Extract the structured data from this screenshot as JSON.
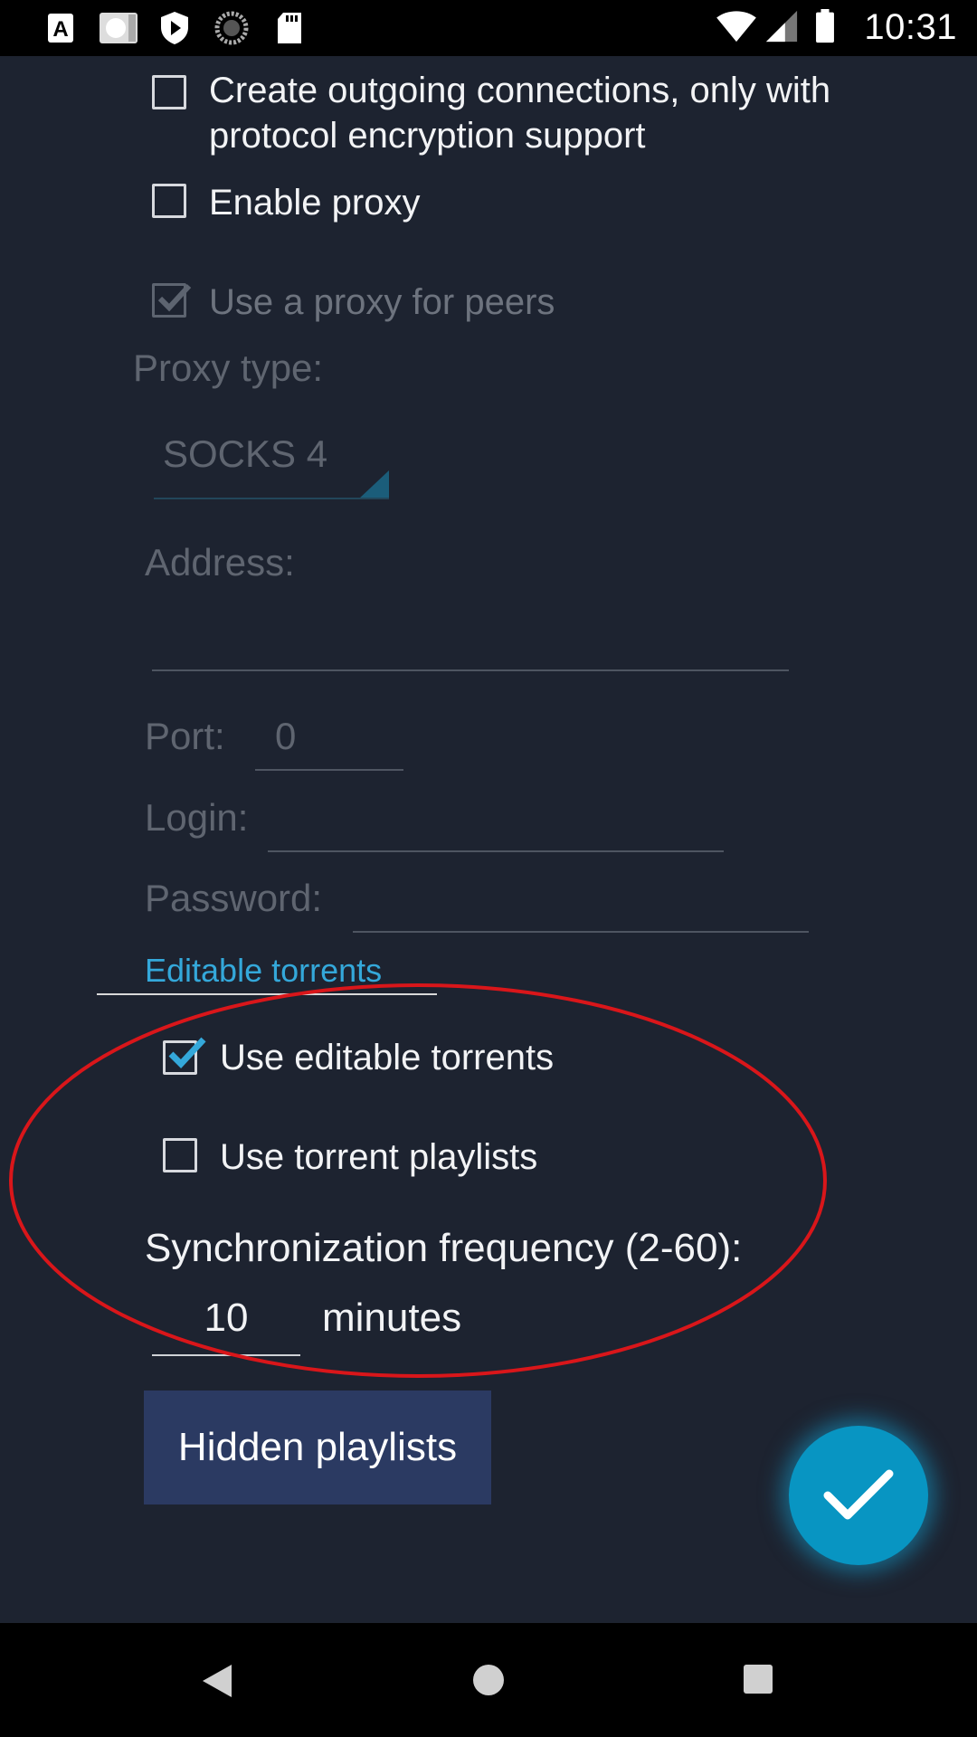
{
  "status_bar": {
    "time": "10:31",
    "left_icons": [
      "accessibility-a-icon",
      "screenshot-icon",
      "play-protect-icon",
      "sync-loading-icon",
      "sd-card-icon"
    ],
    "right_icons": [
      "wifi-icon",
      "signal-icon",
      "battery-icon"
    ]
  },
  "settings": {
    "encryption_only": {
      "label": "Create outgoing connections, only with protocol encryption support",
      "checked": false
    },
    "enable_proxy": {
      "label": "Enable proxy",
      "checked": false
    },
    "proxy_for_peers": {
      "label": "Use a proxy for peers",
      "checked": true,
      "disabled": true
    },
    "proxy_type": {
      "label": "Proxy type:",
      "value": "SOCKS 4"
    },
    "address": {
      "label": "Address:",
      "value": ""
    },
    "port": {
      "label": "Port:",
      "value": "0"
    },
    "login": {
      "label": "Login:",
      "value": ""
    },
    "password": {
      "label": "Password:",
      "value": ""
    }
  },
  "editable_torrents": {
    "section_title": "Editable torrents",
    "use_editable": {
      "label": "Use editable torrents",
      "checked": true
    },
    "use_playlists": {
      "label": "Use torrent playlists",
      "checked": false
    },
    "sync_frequency": {
      "label": "Synchronization frequency (2-60):",
      "value": "10",
      "unit": "minutes"
    },
    "hidden_playlists_button": "Hidden playlists"
  },
  "fab_icon": "checkmark-icon",
  "annotation": {
    "type": "ellipse",
    "color": "#d9161a"
  },
  "nav_bar": [
    "back-icon",
    "home-icon",
    "recents-icon"
  ],
  "colors": {
    "background": "#1d2330",
    "accent": "#34a8da",
    "button": "#2b3a62",
    "fab": "#0895c2"
  }
}
